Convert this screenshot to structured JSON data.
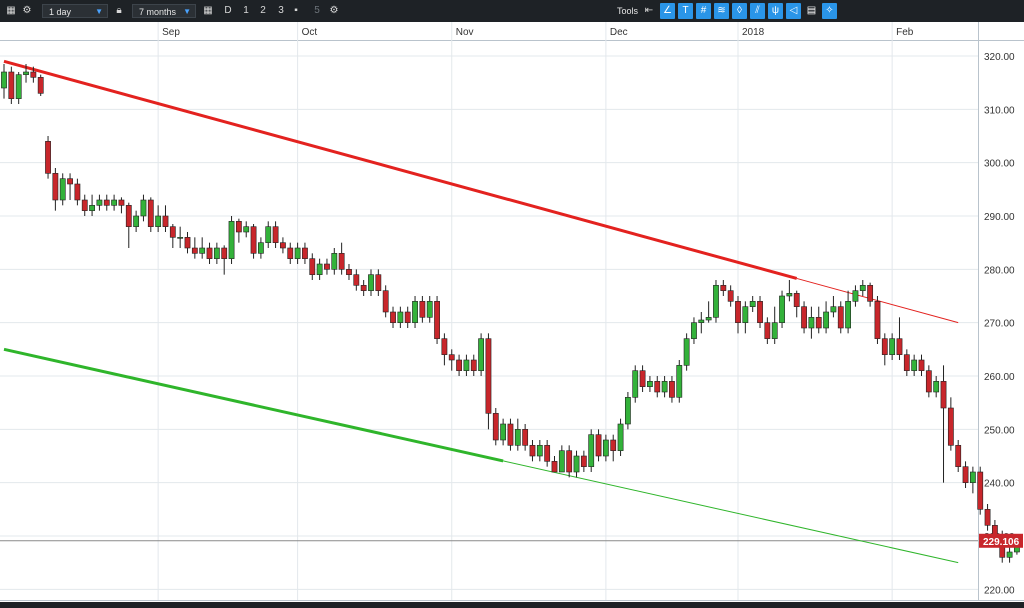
{
  "toolbar": {
    "interval": "1 day",
    "range": "7 months",
    "btn_d": "D",
    "btn_1": "1",
    "btn_2": "2",
    "btn_3": "3",
    "btn_5": "5",
    "tools_label": "Tools"
  },
  "price_tag": "229.106",
  "colors": {
    "up": "#33b23a",
    "down": "#c8262b",
    "resistance": "#e3221f",
    "support": "#2fb52b"
  },
  "chart_data": {
    "type": "candlestick",
    "x_months": [
      "Sep",
      "Oct",
      "Nov",
      "Dec",
      "2018",
      "Feb"
    ],
    "y_ticks": [
      "320.00",
      "310.00",
      "300.00",
      "290.00",
      "280.00",
      "270.00",
      "260.00",
      "250.00",
      "240.00",
      "230.00",
      "220.00"
    ],
    "ylim": [
      218,
      323
    ],
    "last_price": 229.106,
    "candles": [
      [
        314,
        317,
        318.5,
        312
      ],
      [
        317,
        312,
        318,
        311
      ],
      [
        312,
        316.5,
        317,
        311
      ],
      [
        316.5,
        317,
        318.5,
        315
      ],
      [
        317,
        316,
        318,
        315
      ],
      [
        316,
        313,
        316.5,
        312.5
      ],
      [
        304,
        298,
        305,
        297
      ],
      [
        298,
        293,
        299,
        291
      ],
      [
        293,
        297,
        298,
        292
      ],
      [
        297,
        296,
        298,
        293
      ],
      [
        296,
        293,
        297,
        292
      ],
      [
        293,
        291,
        294,
        290
      ],
      [
        291,
        292,
        294,
        290
      ],
      [
        292,
        293,
        294,
        291
      ],
      [
        293,
        292,
        294,
        291
      ],
      [
        292,
        293,
        294,
        291
      ],
      [
        293,
        292,
        293.5,
        290.5
      ],
      [
        292,
        288,
        292.5,
        284
      ],
      [
        288,
        290,
        291,
        287
      ],
      [
        290,
        293,
        294,
        289
      ],
      [
        293,
        288,
        293.5,
        287
      ],
      [
        288,
        290,
        292,
        287
      ],
      [
        290,
        288,
        292,
        287
      ],
      [
        288,
        286,
        288.5,
        284
      ],
      [
        286,
        286,
        288,
        284
      ],
      [
        286,
        284,
        287,
        283
      ],
      [
        284,
        283,
        286,
        282
      ],
      [
        283,
        284,
        286,
        282
      ],
      [
        284,
        282,
        285,
        281
      ],
      [
        282,
        284,
        285,
        281
      ],
      [
        284,
        282,
        284.5,
        279
      ],
      [
        282,
        289,
        290,
        281
      ],
      [
        289,
        287,
        289.5,
        285
      ],
      [
        287,
        288,
        289,
        286
      ],
      [
        288,
        283,
        288.5,
        282
      ],
      [
        283,
        285,
        286,
        282
      ],
      [
        285,
        288,
        289,
        284
      ],
      [
        288,
        285,
        289,
        284
      ],
      [
        285,
        284,
        286,
        283
      ],
      [
        284,
        282,
        285,
        281
      ],
      [
        282,
        284,
        285,
        281
      ],
      [
        284,
        282,
        285,
        281
      ],
      [
        282,
        279,
        283,
        278
      ],
      [
        279,
        281,
        282,
        278
      ],
      [
        281,
        280,
        282,
        279
      ],
      [
        280,
        283,
        284,
        279
      ],
      [
        283,
        280,
        285,
        279
      ],
      [
        280,
        279,
        281,
        278
      ],
      [
        279,
        277,
        280,
        276
      ],
      [
        277,
        276,
        278,
        275
      ],
      [
        276,
        279,
        280,
        275
      ],
      [
        279,
        276,
        280,
        275
      ],
      [
        276,
        272,
        277,
        271
      ],
      [
        272,
        270,
        273,
        269
      ],
      [
        270,
        272,
        273,
        269
      ],
      [
        272,
        270,
        273,
        269
      ],
      [
        270,
        274,
        275,
        269
      ],
      [
        274,
        271,
        275,
        270
      ],
      [
        271,
        274,
        275,
        270
      ],
      [
        274,
        267,
        275,
        266
      ],
      [
        267,
        264,
        268,
        262
      ],
      [
        264,
        263,
        265,
        261
      ],
      [
        263,
        261,
        264,
        260
      ],
      [
        261,
        263,
        264,
        260
      ],
      [
        263,
        261,
        264,
        260
      ],
      [
        261,
        267,
        268,
        260
      ],
      [
        267,
        253,
        268,
        250
      ],
      [
        253,
        248,
        254,
        247
      ],
      [
        248,
        251,
        252,
        247
      ],
      [
        251,
        247,
        252,
        246
      ],
      [
        247,
        250,
        252,
        246
      ],
      [
        250,
        247,
        251,
        246
      ],
      [
        247,
        245,
        248,
        244
      ],
      [
        245,
        247,
        248,
        244
      ],
      [
        247,
        244,
        248,
        243
      ],
      [
        244,
        242,
        245,
        242
      ],
      [
        242,
        246,
        247,
        242
      ],
      [
        246,
        242,
        247,
        241
      ],
      [
        242,
        245,
        246,
        241
      ],
      [
        245,
        243,
        246,
        242
      ],
      [
        243,
        249,
        250,
        242
      ],
      [
        249,
        245,
        250,
        244
      ],
      [
        245,
        248,
        249,
        244
      ],
      [
        248,
        246,
        249,
        244
      ],
      [
        246,
        251,
        252,
        245
      ],
      [
        251,
        256,
        257,
        250
      ],
      [
        256,
        261,
        262,
        255
      ],
      [
        261,
        258,
        262,
        257
      ],
      [
        258,
        259,
        260,
        257
      ],
      [
        259,
        257,
        260,
        256
      ],
      [
        257,
        259,
        260,
        256
      ],
      [
        259,
        256,
        260,
        255
      ],
      [
        256,
        262,
        263,
        255
      ],
      [
        262,
        267,
        268,
        261
      ],
      [
        267,
        270,
        271,
        266
      ],
      [
        270,
        270.5,
        272,
        268
      ],
      [
        270.5,
        271,
        274,
        270
      ],
      [
        271,
        277,
        278,
        270
      ],
      [
        277,
        276,
        278,
        275
      ],
      [
        276,
        274,
        277,
        273
      ],
      [
        274,
        270,
        275,
        268
      ],
      [
        270,
        273,
        274,
        268
      ],
      [
        273,
        274,
        275,
        272
      ],
      [
        274,
        270,
        275,
        269
      ],
      [
        270,
        267,
        271,
        266
      ],
      [
        267,
        270,
        273,
        266
      ],
      [
        270,
        275,
        276,
        269
      ],
      [
        275,
        275.5,
        278,
        274
      ],
      [
        275.5,
        273,
        276,
        271
      ],
      [
        273,
        269,
        274,
        268
      ],
      [
        269,
        271,
        273,
        267
      ],
      [
        271,
        269,
        273,
        268
      ],
      [
        269,
        272,
        274,
        268
      ],
      [
        272,
        273,
        275,
        271
      ],
      [
        273,
        269,
        274,
        268
      ],
      [
        269,
        274,
        276,
        268
      ],
      [
        274,
        276,
        277,
        273
      ],
      [
        276,
        277,
        278,
        275
      ],
      [
        277,
        274,
        277.5,
        273
      ],
      [
        274,
        267,
        275,
        266
      ],
      [
        267,
        264,
        268,
        262
      ],
      [
        264,
        267,
        268,
        263
      ],
      [
        267,
        264,
        271,
        263
      ],
      [
        264,
        261,
        265,
        260
      ],
      [
        261,
        263,
        264,
        260
      ],
      [
        263,
        261,
        264,
        260
      ],
      [
        261,
        257,
        262,
        256
      ],
      [
        257,
        259,
        260,
        256
      ],
      [
        259,
        254,
        262,
        240
      ],
      [
        254,
        247,
        256,
        246
      ],
      [
        247,
        243,
        248,
        242
      ],
      [
        243,
        240,
        244,
        239
      ],
      [
        240,
        242,
        243,
        238
      ],
      [
        242,
        235,
        243,
        234
      ],
      [
        235,
        232,
        236,
        231
      ],
      [
        232,
        230,
        233,
        229
      ],
      [
        230,
        226,
        231,
        225
      ],
      [
        226,
        227,
        228,
        225
      ],
      [
        227,
        229.1,
        230,
        226.5
      ]
    ],
    "trendlines": [
      {
        "name": "resistance",
        "from": [
          0,
          319
        ],
        "to": [
          130,
          270
        ]
      },
      {
        "name": "support",
        "from": [
          0,
          265
        ],
        "to": [
          130,
          225
        ]
      }
    ]
  }
}
